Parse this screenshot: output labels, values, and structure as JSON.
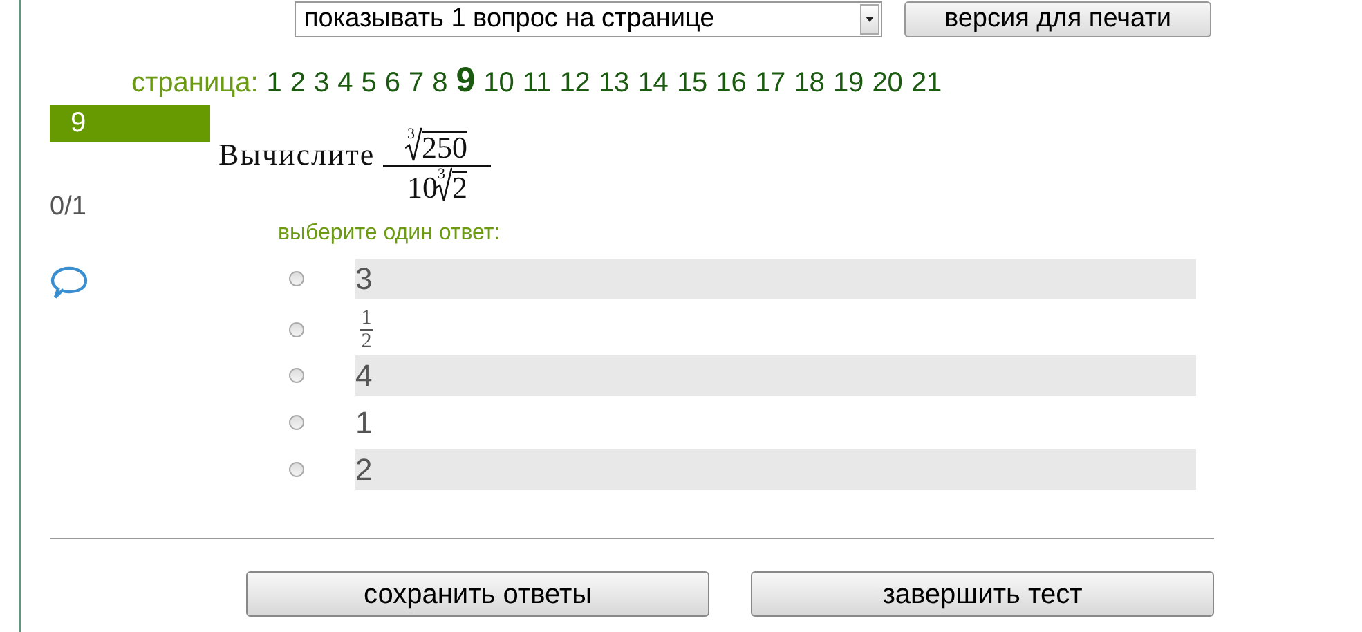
{
  "toolbar": {
    "view_select": {
      "value": "показывать 1 вопрос на странице"
    },
    "print_button": "версия для печати"
  },
  "pagination": {
    "label": "страница:",
    "pages": [
      {
        "label": "1",
        "selected": false
      },
      {
        "label": "2",
        "selected": false
      },
      {
        "label": "3",
        "selected": false
      },
      {
        "label": "4",
        "selected": false
      },
      {
        "label": "5",
        "selected": false
      },
      {
        "label": "6",
        "selected": false
      },
      {
        "label": "7",
        "selected": false
      },
      {
        "label": "8",
        "selected": false
      },
      {
        "label": "9",
        "selected": true
      },
      {
        "label": "10",
        "selected": false
      },
      {
        "label": "11",
        "selected": false
      },
      {
        "label": "12",
        "selected": false
      },
      {
        "label": "13",
        "selected": false
      },
      {
        "label": "14",
        "selected": false
      },
      {
        "label": "15",
        "selected": false
      },
      {
        "label": "16",
        "selected": false
      },
      {
        "label": "17",
        "selected": false
      },
      {
        "label": "18",
        "selected": false
      },
      {
        "label": "19",
        "selected": false
      },
      {
        "label": "20",
        "selected": false
      },
      {
        "label": "21",
        "selected": false
      }
    ]
  },
  "question": {
    "number": "9",
    "score": "0/1",
    "text": "Вычислите",
    "formula": {
      "numerator": {
        "index": "3",
        "radicand": "250"
      },
      "denominator": {
        "coefficient": "10",
        "index": "3",
        "radicand": "2"
      }
    },
    "prompt": "выберите один ответ:",
    "answers": [
      {
        "kind": "text",
        "text": "3",
        "selected": false
      },
      {
        "kind": "fraction",
        "numerator": "1",
        "denominator": "2",
        "selected": false
      },
      {
        "kind": "text",
        "text": "4",
        "selected": false
      },
      {
        "kind": "text",
        "text": "1",
        "selected": false
      },
      {
        "kind": "text",
        "text": "2",
        "selected": false
      }
    ]
  },
  "buttons": [
    {
      "label": "сохранить ответы"
    },
    {
      "label": "завершить тест"
    }
  ]
}
